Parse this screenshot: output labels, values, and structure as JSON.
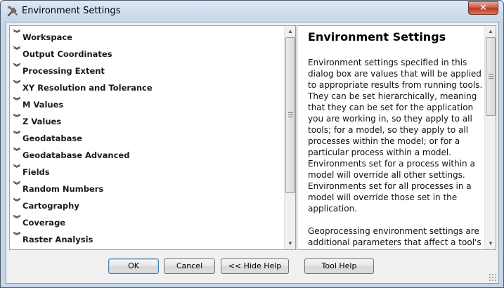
{
  "window": {
    "title": "Environment Settings",
    "close_label": "✕"
  },
  "environments": [
    {
      "label": "Workspace"
    },
    {
      "label": "Output Coordinates"
    },
    {
      "label": "Processing Extent"
    },
    {
      "label": "XY Resolution and Tolerance"
    },
    {
      "label": "M Values"
    },
    {
      "label": "Z Values"
    },
    {
      "label": "Geodatabase"
    },
    {
      "label": "Geodatabase Advanced"
    },
    {
      "label": "Fields"
    },
    {
      "label": "Random Numbers"
    },
    {
      "label": "Cartography"
    },
    {
      "label": "Coverage"
    },
    {
      "label": "Raster Analysis"
    }
  ],
  "help": {
    "title": "Environment Settings",
    "paragraph1": "Environment settings specified in this dialog box are values that will be applied to appropriate results from running tools. They can be set hierarchically, meaning that they can be set for the application you are working in, so they apply to all tools; for a model, so they apply to all processes within the model; or for a particular process within a model. Environments set for a process within a model will override all other settings. Environments set for all processes in a model will override those set in the application.",
    "paragraph2": "Geoprocessing environment settings are additional parameters that affect a tool's"
  },
  "buttons": {
    "ok": "OK",
    "cancel": "Cancel",
    "hide_help": "<< Hide Help",
    "tool_help": "Tool Help"
  },
  "icons": {
    "title": "tools-icon",
    "expand": "double-chevron-down-icon"
  }
}
